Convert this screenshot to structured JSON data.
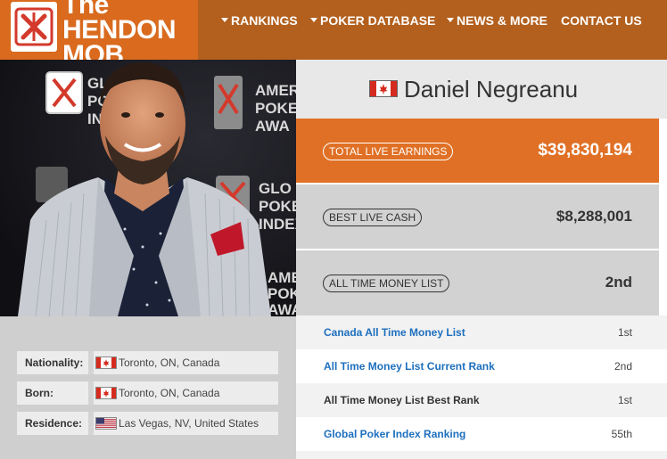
{
  "header": {
    "logo_line1": "The",
    "logo_line2": "HENDON",
    "logo_line3": "MOB",
    "logo_icon": "hendon-mob-logo-icon",
    "nav": [
      {
        "label": "RANKINGS",
        "dropdown": true
      },
      {
        "label": "POKER DATABASE",
        "dropdown": true
      },
      {
        "label": "NEWS & MORE",
        "dropdown": true
      },
      {
        "label": "CONTACT US",
        "dropdown": false
      }
    ]
  },
  "player": {
    "name": "Daniel Negreanu",
    "flag": "canada-flag-icon"
  },
  "photo": {
    "backdrop_words": [
      "GLO",
      "POKE",
      "INDE",
      "AMER",
      "POKE",
      "AWA",
      "GLO",
      "POKE",
      "INDEX",
      "AMER",
      "POKER",
      "AWA"
    ]
  },
  "details": [
    {
      "label": "Nationality:",
      "flag": "canada-flag-icon",
      "value": "Toronto, ON, Canada"
    },
    {
      "label": "Born:",
      "flag": "canada-flag-icon",
      "value": "Toronto, ON, Canada"
    },
    {
      "label": "Residence:",
      "flag": "usa-flag-icon",
      "value": "Las Vegas, NV, United States"
    }
  ],
  "stats": {
    "total_live_earnings": {
      "label": "TOTAL LIVE EARNINGS",
      "value": "$39,830,194"
    },
    "best_live_cash": {
      "label": "BEST LIVE CASH",
      "value": "$8,288,001"
    },
    "all_time_money_list": {
      "label": "ALL TIME MONEY LIST",
      "value": "2nd"
    }
  },
  "rankings": [
    {
      "label": "Canada All Time Money List",
      "value": "1st",
      "link": true
    },
    {
      "label": "All Time Money List Current Rank",
      "value": "2nd",
      "link": true
    },
    {
      "label": "All Time Money List Best Rank",
      "value": "1st",
      "link": false
    },
    {
      "label": "Global Poker Index Ranking",
      "value": "55th",
      "link": true
    }
  ],
  "colors": {
    "header_bg": "#b3601e",
    "logo_bg": "#d96a1e",
    "accent_orange": "#e07025",
    "link_blue": "#1d6fbe",
    "panel_grey": "#d2d2d2"
  }
}
